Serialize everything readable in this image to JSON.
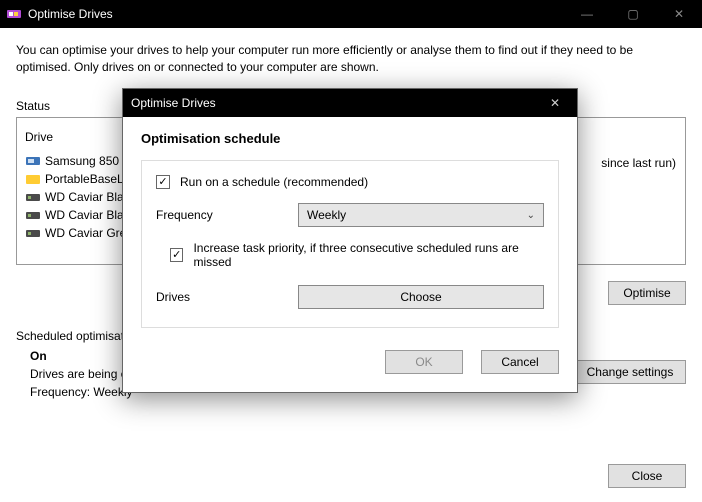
{
  "window": {
    "title": "Optimise Drives",
    "controls": {
      "min": "—",
      "max": "▢",
      "close": "✕"
    }
  },
  "description": "You can optimise your drives to help your computer run more efficiently or analyse them to find out if they need to be optimised. Only drives on or connected to your computer are shown.",
  "status_label": "Status",
  "columns": {
    "drive": "Drive",
    "current": "since last run)"
  },
  "drives": [
    {
      "icon": "ssd",
      "name": "Samsung 850 EVO"
    },
    {
      "icon": "hdd-yellow",
      "name": "PortableBaseLayer"
    },
    {
      "icon": "hdd",
      "name": "WD Caviar Black"
    },
    {
      "icon": "hdd",
      "name": "WD Caviar Black"
    },
    {
      "icon": "hdd",
      "name": "WD Caviar Green"
    }
  ],
  "buttons": {
    "optimise": "Optimise",
    "change_settings": "Change settings",
    "close": "Close"
  },
  "schedule_section": {
    "heading": "Scheduled optimisation",
    "state": "On",
    "line1": "Drives are being optimised automatically.",
    "line2": "Frequency: Weekly"
  },
  "dialog": {
    "title": "Optimise Drives",
    "heading": "Optimisation schedule",
    "run_schedule_label": "Run on a schedule (recommended)",
    "frequency_label": "Frequency",
    "frequency_value": "Weekly",
    "priority_label": "Increase task priority, if three consecutive scheduled runs are missed",
    "drives_label": "Drives",
    "choose_label": "Choose",
    "ok": "OK",
    "cancel": "Cancel",
    "close_glyph": "✕"
  }
}
